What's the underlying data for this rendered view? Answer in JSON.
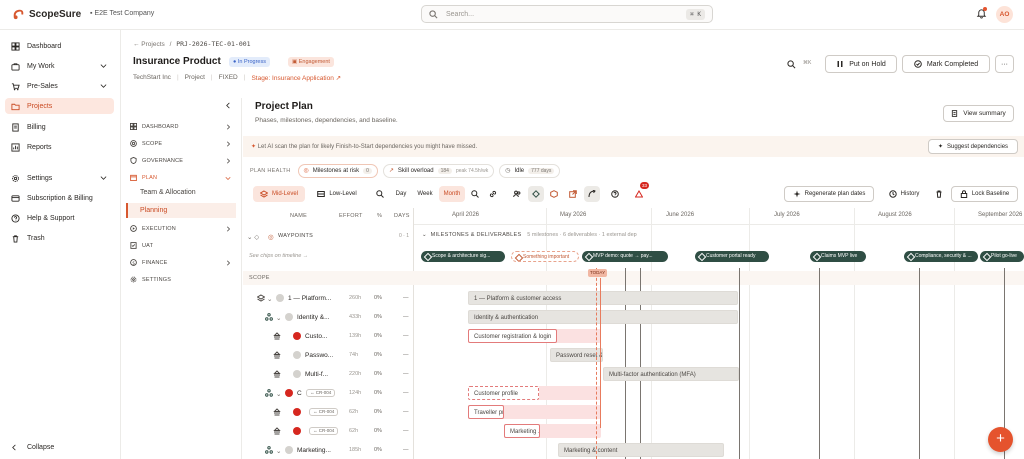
{
  "app": {
    "name": "ScopeSure",
    "company": "E2E Test Company"
  },
  "search": {
    "placeholder": "Search...",
    "shortcut": "⌘ K"
  },
  "user": {
    "initials": "AO"
  },
  "sidebar": {
    "items": [
      {
        "label": "Dashboard",
        "icon": "dashboard-icon"
      },
      {
        "label": "My Work",
        "icon": "briefcase-icon"
      },
      {
        "label": "Pre-Sales",
        "icon": "cart-icon"
      },
      {
        "label": "Projects",
        "icon": "folder-icon",
        "active": true
      },
      {
        "label": "Billing",
        "icon": "billing-icon"
      },
      {
        "label": "Reports",
        "icon": "report-icon"
      },
      {
        "label": "Settings",
        "icon": "gear-icon"
      },
      {
        "label": "Subscription & Billing",
        "icon": "card-icon"
      },
      {
        "label": "Help & Support",
        "icon": "help-icon"
      },
      {
        "label": "Trash",
        "icon": "trash-icon"
      }
    ],
    "collapse_label": "Collapse"
  },
  "project": {
    "back_label": "← Projects",
    "separator": "/",
    "code": "PRJ-2026-TEC-01-001",
    "title": "Insurance Product",
    "status": "In Progress",
    "tag": "Engagement",
    "client": "TechStart Inc",
    "type": "Project",
    "pricing": "FIXED",
    "stage": "Stage: Insurance Application",
    "k_badge": "⌘K",
    "buttons": {
      "hold": "Put on Hold",
      "complete": "Mark Completed",
      "more": "···"
    }
  },
  "subnav": {
    "items": [
      "DASHBOARD",
      "SCOPE",
      "GOVERNANCE",
      "PLAN",
      "EXECUTION",
      "UAT",
      "FINANCE",
      "SETTINGS"
    ],
    "plan_children": [
      "Team & Allocation",
      "Planning"
    ]
  },
  "plan": {
    "title": "Project Plan",
    "subtitle": "Phases, milestones, dependencies, and baseline.",
    "view_summary": "View summary",
    "ai_banner": "Let AI scan the plan for likely Finish-to-Start dependencies you might have missed.",
    "suggest_label": "Suggest dependencies",
    "health": {
      "label": "PLAN HEALTH",
      "milestones_label": "Milestones at risk",
      "milestones_count": "0",
      "overload_label": "Skill overload",
      "overload_count": "184",
      "overload_peak": "peak 74.5h/wk",
      "idle_label": "Idle",
      "idle_count": "777 days"
    },
    "toolbar": {
      "mid_level": "Mid-Level",
      "low_level": "Low-Level",
      "day": "Day",
      "week": "Week",
      "month": "Month",
      "alert_count": "33",
      "regenerate": "Regenerate plan dates",
      "history": "History",
      "lock": "Lock Baseline"
    },
    "columns": {
      "name": "NAME",
      "effort": "EFFORT",
      "pct": "%",
      "days": "DAYS"
    },
    "months": [
      "April 2026",
      "May 2026",
      "June 2026",
      "July 2026",
      "August 2026",
      "September 2026"
    ],
    "waypoints": {
      "label": "WAYPOINTS",
      "count": "0 · 1",
      "hint": "See chips on timeline →"
    },
    "milestones_header": "MILESTONES & DELIVERABLES",
    "milestones_meta": "5 milestones · 6 deliverables · 1 external dep",
    "milestone_chips": [
      "Scope & architecture sig...",
      "Something important",
      "MVP demo: quote → pay...",
      "Customer portal ready",
      "Claims MVP live",
      "Compliance, security & ...",
      "Pilot go-live"
    ],
    "today_label": "TODAY",
    "scope_label": "SCOPE",
    "rows": [
      {
        "name": "1 — Platform...",
        "effort": "260h",
        "pct": "0%",
        "days": "—"
      },
      {
        "name": "Identity &...",
        "effort": "433h",
        "pct": "0%",
        "days": "—"
      },
      {
        "name": "Custo...",
        "effort": "139h",
        "pct": "0%",
        "days": "—"
      },
      {
        "name": "Passwo...",
        "effort": "74h",
        "pct": "0%",
        "days": "—"
      },
      {
        "name": "Multi-f...",
        "effort": "220h",
        "pct": "0%",
        "days": "—"
      },
      {
        "name": "C",
        "cr": "CR-004",
        "effort": "124h",
        "pct": "0%",
        "days": "—"
      },
      {
        "cr": "CR-004",
        "effort": "62h",
        "pct": "0%",
        "days": "—"
      },
      {
        "cr": "CR-004",
        "effort": "62h",
        "pct": "0%",
        "days": "—"
      },
      {
        "name": "Marketing...",
        "effort": "185h",
        "pct": "0%",
        "days": "—"
      }
    ],
    "bars": [
      "1 — Platform & customer access",
      "Identity & authentication",
      "Customer registration & login",
      "Password reset & ...",
      "Multi-factor authentication (MFA)",
      "Customer profile",
      "Traveller pr...",
      "Marketing ...",
      "Marketing & content"
    ]
  },
  "fab_label": "+"
}
